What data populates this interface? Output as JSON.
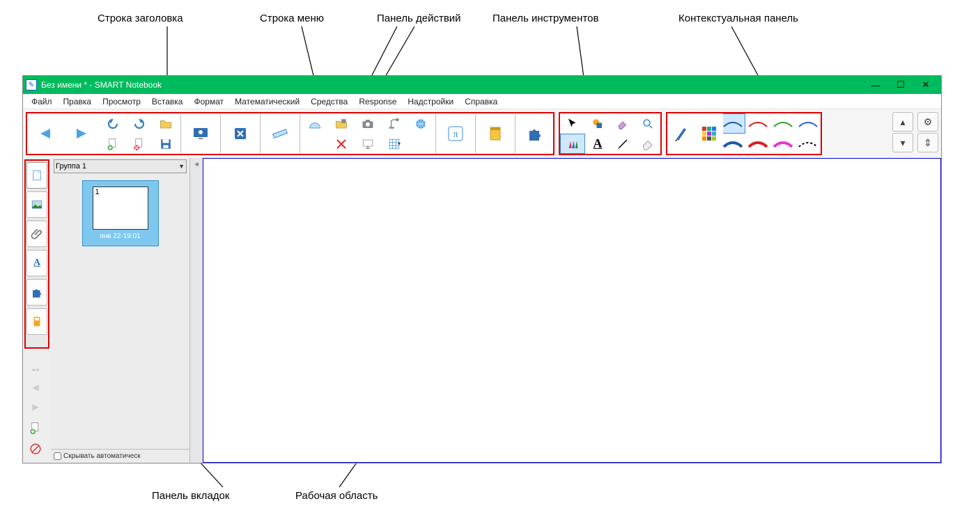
{
  "titlebar": {
    "title": "Без имени * - SMART Notebook"
  },
  "menu": [
    "Файл",
    "Правка",
    "Просмотр",
    "Вставка",
    "Формат",
    "Математический",
    "Средства",
    "Response",
    "Надстройки",
    "Справка"
  ],
  "sidebar": {
    "group_label": "Группа 1",
    "page_number": "1",
    "page_caption": "янв 22-19:01",
    "autohide_label": "Скрывать автоматическ"
  },
  "annotations": {
    "title_bar": "Строка заголовка",
    "menu_bar": "Строка меню",
    "actions_panel": "Панель действий",
    "tools_panel": "Панель инструментов",
    "contextual_panel": "Контекстуальная панель",
    "tabs_panel": "Панель вкладок",
    "work_area": "Рабочая область"
  }
}
